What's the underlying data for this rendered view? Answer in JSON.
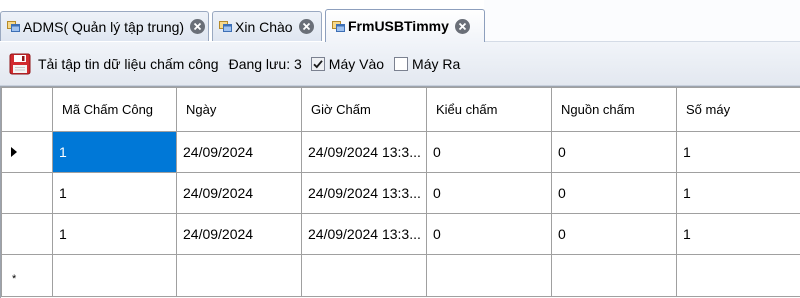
{
  "tabs": [
    {
      "label": "ADMS( Quản lý tập trung)",
      "active": false
    },
    {
      "label": "Xin Chào",
      "active": false
    },
    {
      "label": "FrmUSBTimmy",
      "active": true
    }
  ],
  "toolbar": {
    "load_button_label": "Tải tập tin dữ liệu chấm công",
    "saving_label": "Đang lưu: 3",
    "checkbox_in": {
      "label": "Máy Vào",
      "checked": true
    },
    "checkbox_out": {
      "label": "Máy Ra",
      "checked": false
    }
  },
  "grid": {
    "columns": [
      "Mã Chấm Công",
      "Ngày",
      "Giờ Chấm",
      "Kiểu chấm",
      "Nguồn chấm",
      "Số máy"
    ],
    "rows": [
      [
        "1",
        "24/09/2024",
        "24/09/2024 13:3...",
        "0",
        "0",
        "1"
      ],
      [
        "1",
        "24/09/2024",
        "24/09/2024 13:3...",
        "0",
        "0",
        "1"
      ],
      [
        "1",
        "24/09/2024",
        "24/09/2024 13:3...",
        "0",
        "0",
        "1"
      ]
    ],
    "new_row_marker": "*"
  },
  "icons": {
    "tab_icon": "form-window-icon",
    "tab_close": "close-circle-icon",
    "load_button": "floppy-disk-icon",
    "current_row": "row-pointer-icon"
  },
  "colors": {
    "selection": "#0078d7",
    "tab_close": "#6a6f78",
    "floppy": "#c8262a"
  }
}
